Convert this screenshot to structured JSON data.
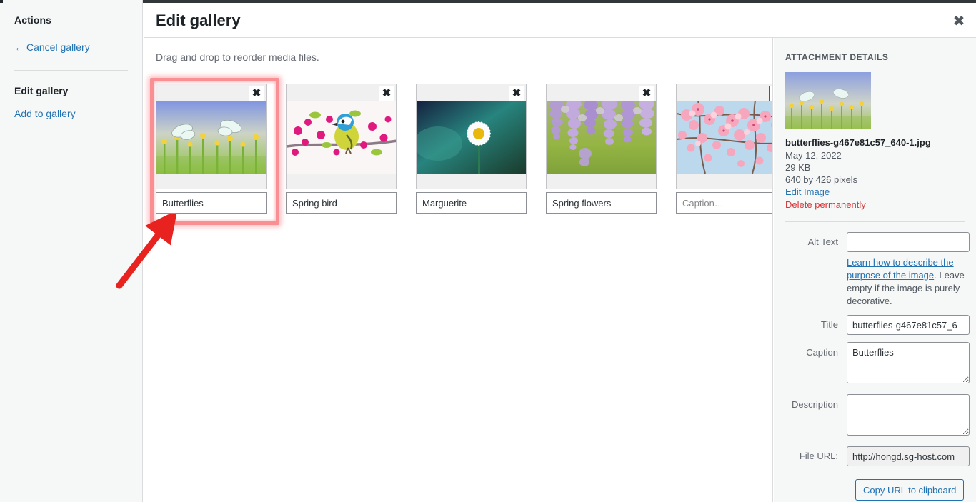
{
  "sidebar": {
    "actions_heading": "Actions",
    "cancel_label": "Cancel gallery",
    "cancel_arrow": "←",
    "edit_heading": "Edit gallery",
    "add_label": "Add to gallery"
  },
  "header": {
    "title": "Edit gallery",
    "close_glyph": "✖"
  },
  "gallery": {
    "hint": "Drag and drop to reorder media files.",
    "remove_glyph": "✖",
    "items": [
      {
        "caption": "Butterflies",
        "placeholder": "Caption…",
        "selected": true,
        "alt": "butterflies on white daisies"
      },
      {
        "caption": "Spring bird",
        "placeholder": "Caption…",
        "selected": false,
        "alt": "blue tit on blossom branch"
      },
      {
        "caption": "Marguerite",
        "placeholder": "Caption…",
        "selected": false,
        "alt": "white daisy on teal background"
      },
      {
        "caption": "Spring flowers",
        "placeholder": "Caption…",
        "selected": false,
        "alt": "purple wisteria blossoms"
      },
      {
        "caption": "",
        "placeholder": "Caption…",
        "selected": false,
        "alt": "pink cherry blossoms"
      }
    ]
  },
  "details": {
    "heading": "ATTACHMENT DETAILS",
    "filename": "butterflies-g467e81c57_640-1.jpg",
    "date": "May 12, 2022",
    "filesize": "29 KB",
    "dimensions": "640 by 426 pixels",
    "edit_image_label": "Edit Image",
    "delete_label": "Delete permanently",
    "fields": {
      "alt_label": "Alt Text",
      "alt_value": "",
      "alt_help_link": "Learn how to describe the purpose of the image",
      "alt_help_rest": ". Leave empty if the image is purely decorative.",
      "title_label": "Title",
      "title_value": "butterflies-g467e81c57_6",
      "caption_label": "Caption",
      "caption_value": "Butterflies",
      "description_label": "Description",
      "description_value": "",
      "file_url_label": "File URL:",
      "file_url_value": "http://hongd.sg-host.com",
      "copy_label": "Copy URL to clipboard"
    }
  },
  "annotation": {
    "arrow_color": "#e8221f",
    "highlight_color": "#f98e93"
  }
}
